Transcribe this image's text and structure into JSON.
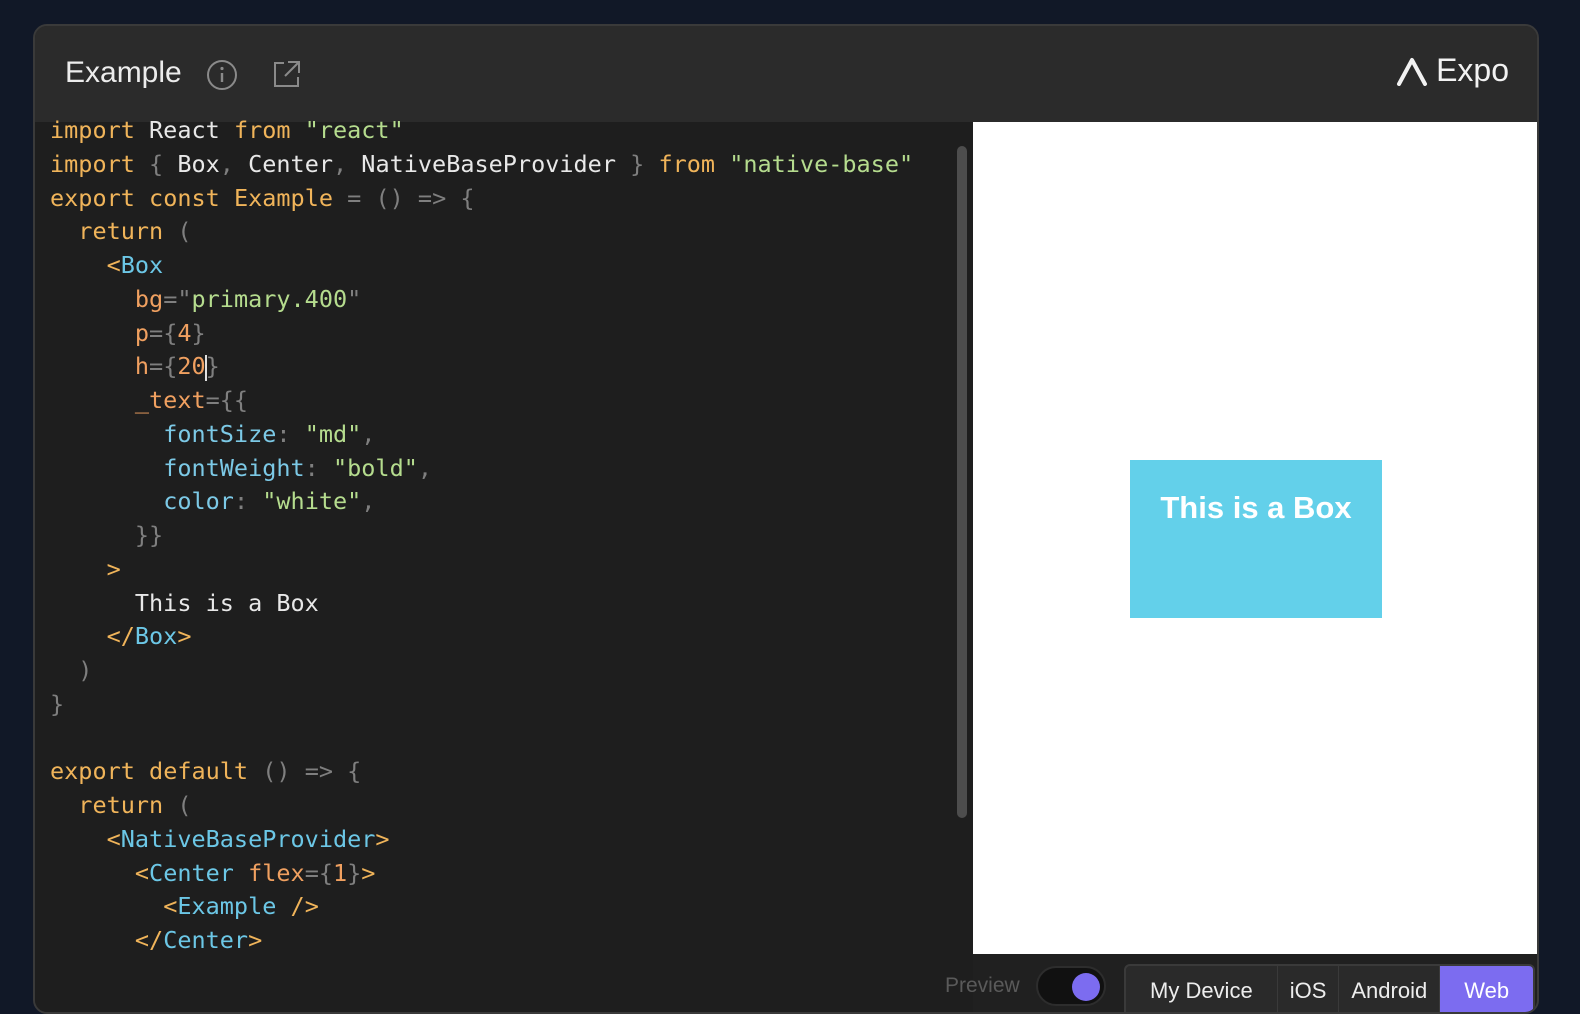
{
  "header": {
    "title": "Example",
    "brand": "Expo"
  },
  "editor": {
    "lines": [
      [
        [
          "kw",
          "import"
        ],
        [
          "tx",
          " React "
        ],
        [
          "kw",
          "from"
        ],
        [
          "tx",
          " "
        ],
        [
          "st",
          "\"react\""
        ]
      ],
      [
        [
          "kw",
          "import"
        ],
        [
          "tx",
          " "
        ],
        [
          "pu",
          "{"
        ],
        [
          "tx",
          " Box"
        ],
        [
          "pu",
          ","
        ],
        [
          "tx",
          " Center"
        ],
        [
          "pu",
          ","
        ],
        [
          "tx",
          " NativeBaseProvider "
        ],
        [
          "pu",
          "}"
        ],
        [
          "tx",
          " "
        ],
        [
          "kw",
          "from"
        ],
        [
          "tx",
          " "
        ],
        [
          "st",
          "\"native-base\""
        ]
      ],
      [
        [
          "kw",
          "export"
        ],
        [
          "tx",
          " "
        ],
        [
          "kw",
          "const"
        ],
        [
          "tx",
          " "
        ],
        [
          "kw",
          "Example"
        ],
        [
          "tx",
          " "
        ],
        [
          "pu",
          "="
        ],
        [
          "tx",
          " "
        ],
        [
          "pu",
          "()"
        ],
        [
          "tx",
          " "
        ],
        [
          "pu",
          "=>"
        ],
        [
          "tx",
          " "
        ],
        [
          "pu",
          "{"
        ]
      ],
      [
        [
          "tx",
          "  "
        ],
        [
          "kw",
          "return"
        ],
        [
          "tx",
          " "
        ],
        [
          "pu",
          "("
        ]
      ],
      [
        [
          "tx",
          "    "
        ],
        [
          "kw",
          "<"
        ],
        [
          "tg",
          "Box"
        ]
      ],
      [
        [
          "tx",
          "      "
        ],
        [
          "at",
          "bg"
        ],
        [
          "pu",
          "="
        ],
        [
          "pu",
          "\""
        ],
        [
          "st",
          "primary.400"
        ],
        [
          "pu",
          "\""
        ]
      ],
      [
        [
          "tx",
          "      "
        ],
        [
          "at",
          "p"
        ],
        [
          "pu",
          "={"
        ],
        [
          "nu",
          "4"
        ],
        [
          "pu",
          "}"
        ]
      ],
      [
        [
          "tx",
          "      "
        ],
        [
          "at",
          "h"
        ],
        [
          "pu",
          "={"
        ],
        [
          "nu",
          "20"
        ],
        [
          "caret",
          ""
        ],
        [
          "pu",
          "}"
        ]
      ],
      [
        [
          "tx",
          "      "
        ],
        [
          "at",
          "_text"
        ],
        [
          "pu",
          "={{"
        ]
      ],
      [
        [
          "tx",
          "        "
        ],
        [
          "pr",
          "fontSize"
        ],
        [
          "pu",
          ":"
        ],
        [
          "tx",
          " "
        ],
        [
          "st",
          "\"md\""
        ],
        [
          "pu",
          ","
        ]
      ],
      [
        [
          "tx",
          "        "
        ],
        [
          "pr",
          "fontWeight"
        ],
        [
          "pu",
          ":"
        ],
        [
          "tx",
          " "
        ],
        [
          "st",
          "\"bold\""
        ],
        [
          "pu",
          ","
        ]
      ],
      [
        [
          "tx",
          "        "
        ],
        [
          "pr",
          "color"
        ],
        [
          "pu",
          ":"
        ],
        [
          "tx",
          " "
        ],
        [
          "st",
          "\"white\""
        ],
        [
          "pu",
          ","
        ]
      ],
      [
        [
          "tx",
          "      "
        ],
        [
          "pu",
          "}}"
        ]
      ],
      [
        [
          "tx",
          "    "
        ],
        [
          "kw",
          ">"
        ]
      ],
      [
        [
          "tx",
          "      This is a Box"
        ]
      ],
      [
        [
          "tx",
          "    "
        ],
        [
          "kw",
          "</"
        ],
        [
          "tg",
          "Box"
        ],
        [
          "kw",
          ">"
        ]
      ],
      [
        [
          "tx",
          "  "
        ],
        [
          "pu",
          ")"
        ]
      ],
      [
        [
          "pu",
          "}"
        ]
      ],
      [
        [
          "tx",
          ""
        ]
      ],
      [
        [
          "kw",
          "export"
        ],
        [
          "tx",
          " "
        ],
        [
          "kw",
          "default"
        ],
        [
          "tx",
          " "
        ],
        [
          "pu",
          "()"
        ],
        [
          "tx",
          " "
        ],
        [
          "pu",
          "=>"
        ],
        [
          "tx",
          " "
        ],
        [
          "pu",
          "{"
        ]
      ],
      [
        [
          "tx",
          "  "
        ],
        [
          "kw",
          "return"
        ],
        [
          "tx",
          " "
        ],
        [
          "pu",
          "("
        ]
      ],
      [
        [
          "tx",
          "    "
        ],
        [
          "kw",
          "<"
        ],
        [
          "tg",
          "NativeBaseProvider"
        ],
        [
          "kw",
          ">"
        ]
      ],
      [
        [
          "tx",
          "      "
        ],
        [
          "kw",
          "<"
        ],
        [
          "tg",
          "Center"
        ],
        [
          "tx",
          " "
        ],
        [
          "at",
          "flex"
        ],
        [
          "pu",
          "={"
        ],
        [
          "nu",
          "1"
        ],
        [
          "pu",
          "}"
        ],
        [
          "kw",
          ">"
        ]
      ],
      [
        [
          "tx",
          "        "
        ],
        [
          "kw",
          "<"
        ],
        [
          "tg",
          "Example"
        ],
        [
          "tx",
          " "
        ],
        [
          "kw",
          "/>"
        ]
      ],
      [
        [
          "tx",
          "      "
        ],
        [
          "kw",
          "</"
        ],
        [
          "tg",
          "Center"
        ],
        [
          "kw",
          ">"
        ]
      ]
    ]
  },
  "preview": {
    "box_text": "This is a Box",
    "box_color": "#63d0ea",
    "toggle_label": "Preview",
    "toggle_on": true
  },
  "platforms": [
    {
      "label": "My Device",
      "active": false
    },
    {
      "label": "iOS",
      "active": false
    },
    {
      "label": "Android",
      "active": false
    },
    {
      "label": "Web",
      "active": true
    }
  ],
  "colors": {
    "accent": "#7c6cf0",
    "keyword": "#f0b45a",
    "string": "#b5dc8e",
    "tag": "#6cc7e6"
  }
}
